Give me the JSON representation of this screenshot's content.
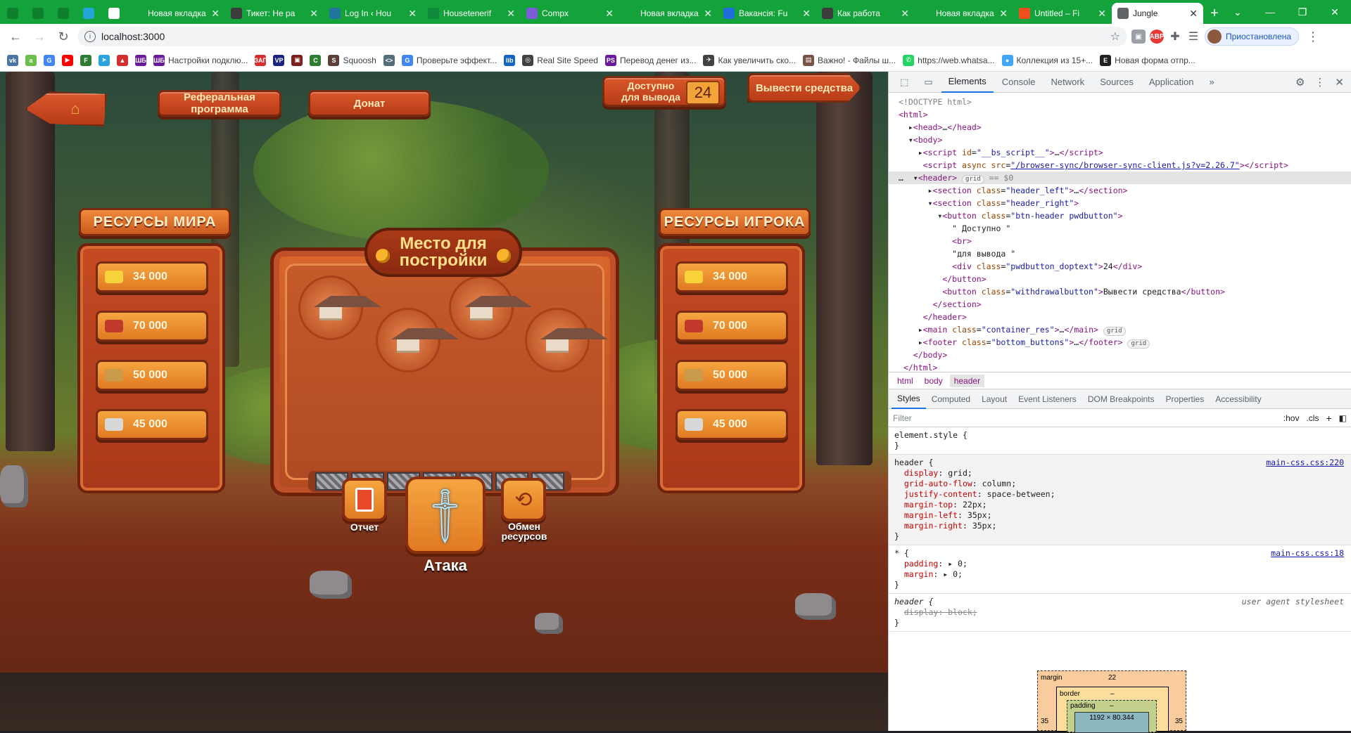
{
  "tabs": [
    {
      "title": "",
      "fav_color": "#0f7f2d",
      "small": true
    },
    {
      "title": "",
      "fav_color": "#0f7f2d",
      "small": true
    },
    {
      "title": "",
      "fav_color": "#0f7f2d",
      "small": true
    },
    {
      "title": "",
      "fav_color": "#21a6d6",
      "small": true
    },
    {
      "title": "",
      "fav_color": "#ffffff",
      "small": true
    },
    {
      "title": "Новая вкладка",
      "fav_color": "#13a33a"
    },
    {
      "title": "Тикет: Не ра",
      "fav_color": "#3c3c3c"
    },
    {
      "title": "Log In ‹ Hou",
      "fav_color": "#21759b"
    },
    {
      "title": "Housetenerif",
      "fav_color": "#0f8a3a"
    },
    {
      "title": "Compx",
      "fav_color": "#7b5cd6"
    },
    {
      "title": "Новая вкладка",
      "fav_color": "#13a33a"
    },
    {
      "title": "Вакансія: Fu",
      "fav_color": "#1e6fd9"
    },
    {
      "title": "Как работа",
      "fav_color": "#3c3c3c"
    },
    {
      "title": "Новая вкладка",
      "fav_color": "#13a33a"
    },
    {
      "title": "Untitled – Fi",
      "fav_color": "#f24e1e"
    },
    {
      "title": "Jungle",
      "fav_color": "#5f6368",
      "active": true
    }
  ],
  "toolbar": {
    "url": "localhost:3000",
    "profile_label": "Приостановлена"
  },
  "bookmarks": [
    {
      "label": "",
      "color": "#4c75a3",
      "glyph": "vk"
    },
    {
      "label": "",
      "color": "#6cc04a",
      "glyph": "a"
    },
    {
      "label": "",
      "color": "#4285f4",
      "glyph": "G"
    },
    {
      "label": "",
      "color": "#ff0000",
      "glyph": "▶"
    },
    {
      "label": "",
      "color": "#2e7d32",
      "glyph": "F"
    },
    {
      "label": "",
      "color": "#2aa3df",
      "glyph": "➤"
    },
    {
      "label": "",
      "color": "#d32f2f",
      "glyph": "▲"
    },
    {
      "label": "",
      "color": "#6a1b9a",
      "glyph": "ШБ"
    },
    {
      "label": "Настройки подклю...",
      "color": "#6a1b9a",
      "glyph": "ШБ"
    },
    {
      "label": "",
      "color": "#d32f2f",
      "glyph": "ЗАП"
    },
    {
      "label": "",
      "color": "#1a237e",
      "glyph": "VP"
    },
    {
      "label": "",
      "color": "#7b1f1f",
      "glyph": "▣"
    },
    {
      "label": "",
      "color": "#2e7d32",
      "glyph": "C"
    },
    {
      "label": "Squoosh",
      "color": "#5d4037",
      "glyph": "S"
    },
    {
      "label": "",
      "color": "#546e7a",
      "glyph": "<>"
    },
    {
      "label": "Проверьте эффект...",
      "color": "#4285f4",
      "glyph": "G"
    },
    {
      "label": "",
      "color": "#1565c0",
      "glyph": "lib"
    },
    {
      "label": "Real Site Speed",
      "color": "#424242",
      "glyph": "◎"
    },
    {
      "label": "Перевод денег из...",
      "color": "#6a1b9a",
      "glyph": "PS"
    },
    {
      "label": "Как увеличить ско...",
      "color": "#424242",
      "glyph": "✈"
    },
    {
      "label": "Важно! - Файлы ш...",
      "color": "#795548",
      "glyph": "▤"
    },
    {
      "label": "https://web.whatsa...",
      "color": "#25d366",
      "glyph": "✆"
    },
    {
      "label": "Коллекция из 15+...",
      "color": "#42a5f5",
      "glyph": "●"
    },
    {
      "label": "Новая форма отпр...",
      "color": "#212121",
      "glyph": "E"
    }
  ],
  "game": {
    "referral_label": "Реферальная программа",
    "donate_label": "Донат",
    "available_line1": "Доступно",
    "available_line2": "для вывода",
    "available_value": "24",
    "withdraw_label": "Вывести средства",
    "world_resources_title": "РЕСУРСЫ МИРА",
    "player_resources_title": "РЕСУРСЫ ИГРОКА",
    "world_resources": [
      {
        "value": "34 000",
        "icon": "gold-icon",
        "color": "#f7d23a"
      },
      {
        "value": "70 000",
        "icon": "meat-icon",
        "color": "#c0392b"
      },
      {
        "value": "50 000",
        "icon": "wood-icon",
        "color": "#c99a4a"
      },
      {
        "value": "45 000",
        "icon": "stone-icon",
        "color": "#d7d7d7"
      }
    ],
    "player_resources": [
      {
        "value": "34 000",
        "icon": "gold-icon",
        "color": "#f7d23a"
      },
      {
        "value": "70 000",
        "icon": "meat-icon",
        "color": "#c0392b"
      },
      {
        "value": "50 000",
        "icon": "wood-icon",
        "color": "#c99a4a"
      },
      {
        "value": "45 000",
        "icon": "stone-icon",
        "color": "#d7d7d7"
      }
    ],
    "build_title_line1": "Место для",
    "build_title_line2": "постройки",
    "report_label": "Отчет",
    "attack_label": "Атака",
    "exchange_line1": "Обмен",
    "exchange_line2": "ресурсов"
  },
  "devtools": {
    "tabs": [
      "Elements",
      "Console",
      "Network",
      "Sources",
      "Application"
    ],
    "active_tab": "Elements",
    "crumbs": [
      "html",
      "body",
      "header"
    ],
    "sub_tabs": [
      "Styles",
      "Computed",
      "Layout",
      "Event Listeners",
      "DOM Breakpoints",
      "Properties",
      "Accessibility"
    ],
    "filter_placeholder": "Filter",
    "filter_hov": ":hov",
    "filter_cls": ".cls",
    "source_main_220": "main-css.css:220",
    "source_main_18": "main-css.css:18",
    "source_ua": "user agent stylesheet",
    "box_margin_label": "margin",
    "box_margin_value": "22",
    "box_border_label": "border",
    "box_border_value": "–",
    "box_padding_label": "padding",
    "box_padding_value": "–",
    "box_content": "1192 × 80.344",
    "box_left": "35",
    "box_right": "35"
  }
}
